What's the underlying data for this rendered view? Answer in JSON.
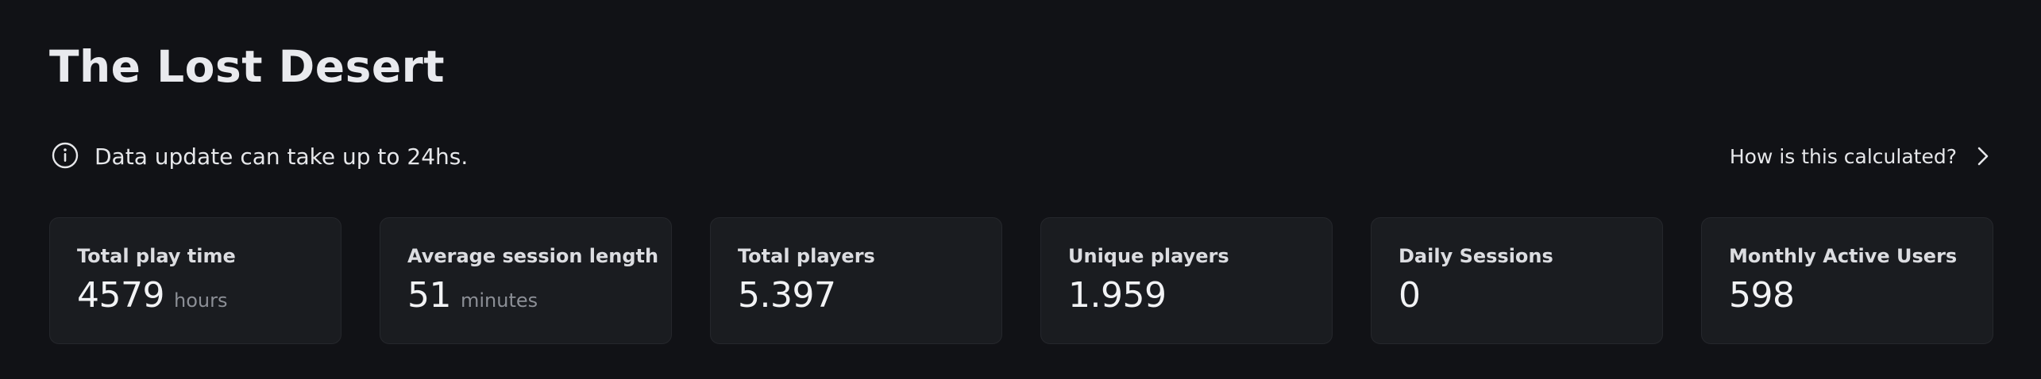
{
  "header": {
    "title": "The Lost Desert"
  },
  "notice": {
    "icon": "info-icon",
    "text": "Data update can take up to 24hs.",
    "help_link_label": "How is this calculated?",
    "help_link_icon": "chevron-right-icon"
  },
  "stats": [
    {
      "label": "Total play time",
      "value": "4579",
      "unit": "hours"
    },
    {
      "label": "Average session length",
      "value": "51",
      "unit": "minutes"
    },
    {
      "label": "Total players",
      "value": "5.397",
      "unit": ""
    },
    {
      "label": "Unique players",
      "value": "1.959",
      "unit": ""
    },
    {
      "label": "Daily Sessions",
      "value": "0",
      "unit": ""
    },
    {
      "label": "Monthly Active Users",
      "value": "598",
      "unit": ""
    }
  ],
  "colors": {
    "background": "#111216",
    "card_background": "#1a1c20",
    "card_border": "#25272c",
    "text_primary": "#eceef1",
    "text_muted": "#8c8f96"
  }
}
